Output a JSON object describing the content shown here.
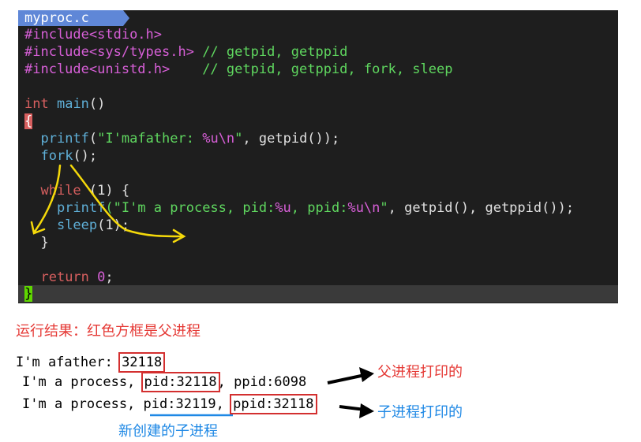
{
  "editor": {
    "tab_title": "myproc.c",
    "lines": [
      {
        "pre": "#include",
        "mid": "<stdio.h>",
        "comment": ""
      },
      {
        "pre": "#include",
        "mid": "<sys/types.h>",
        "comment": " // getpid, getppid"
      },
      {
        "pre": "#include",
        "mid": "<unistd.h>",
        "comment": "    // getpid, getppid, fork, sleep"
      }
    ],
    "main_kw": "int",
    "main_name": "main",
    "main_parens": "()",
    "open_brace": "{",
    "printf1_fn": "printf",
    "printf1_str_a": "\"I'mafather: ",
    "printf1_fmt": "%u\\n",
    "printf1_str_b": "\"",
    "printf1_rest": ", getpid());",
    "fork_fn": "fork",
    "fork_rest": "();",
    "while_kw": "while",
    "while_cond": " (1) {",
    "printf2_fn": "printf",
    "printf2_str_a": "(\"I'm a process, pid:",
    "printf2_fmt1": "%u",
    "printf2_str_b": ", ppid:",
    "printf2_fmt2": "%u\\n",
    "printf2_str_c": "\"",
    "printf2_rest": ", getpid(), getppid());",
    "sleep_fn": "sleep",
    "sleep_rest": "(1);",
    "close_while": "}",
    "return_kw": "return",
    "return_val": "0",
    "return_semi": ";",
    "close_brace": "}"
  },
  "output": {
    "caption": "运行结果：红色方框是父进程",
    "line1_prefix": "I'm afather: ",
    "line1_pid": "32118",
    "line2_prefix": "I'm a process, ",
    "line2_pid": "pid:32118",
    "line2_suffix": ", ppid:6098",
    "line3_prefix": "I'm a process, ",
    "line3_pid": "pid:32119",
    "line3_sep": ", ",
    "line3_ppid": "ppid:32118",
    "parent_note": "父进程打印的",
    "child_note": "子进程打印的",
    "new_child_note": "新创建的子进程"
  },
  "colors": {
    "annotation_red": "#e53935",
    "annotation_blue": "#1e88e5",
    "highlight_box": "#d32f2f",
    "arrow_yellow": "#f5d90a"
  }
}
